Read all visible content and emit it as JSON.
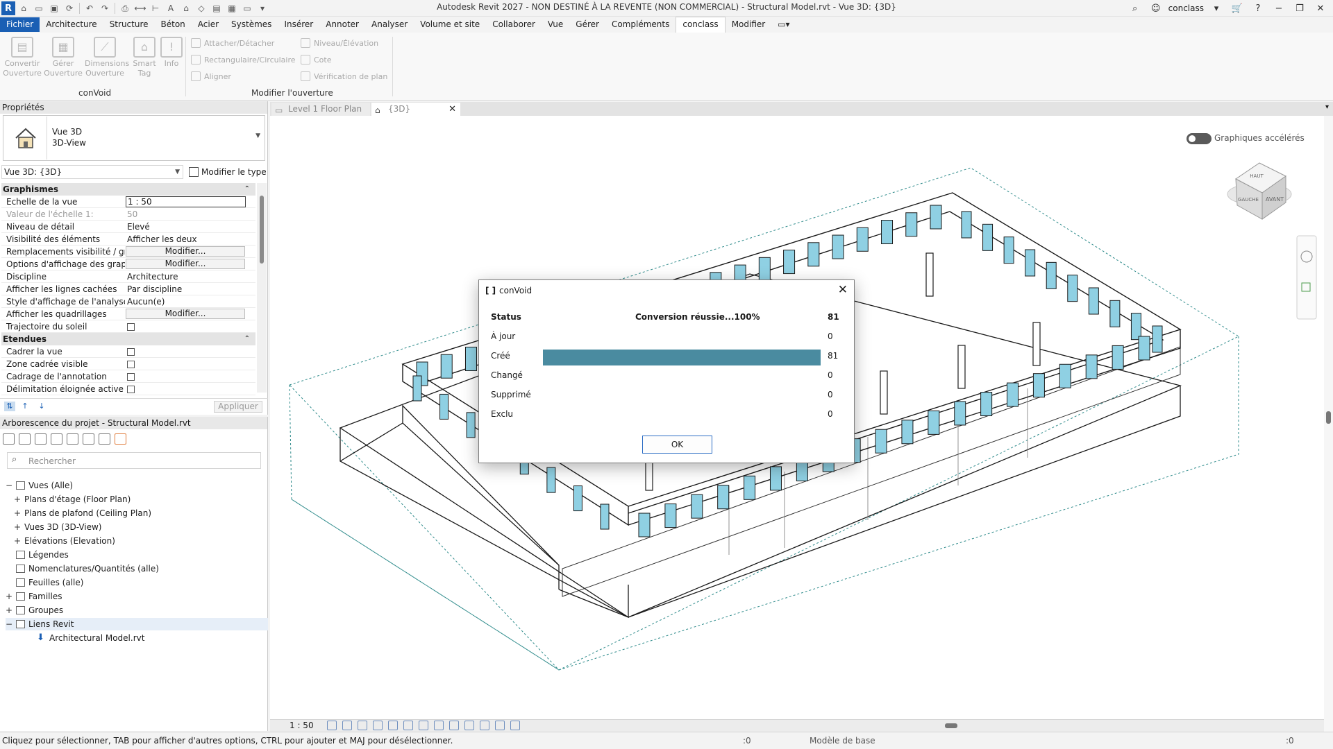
{
  "window": {
    "title": "Autodesk Revit 2027 - NON DESTINÉ À LA REVENTE (NON COMMERCIAL) - Structural Model.rvt - Vue 3D: {3D}",
    "app_letter": "R",
    "user": "conclass",
    "help": "?"
  },
  "menu": {
    "items": [
      "Fichier",
      "Architecture",
      "Structure",
      "Béton",
      "Acier",
      "Systèmes",
      "Insérer",
      "Annoter",
      "Analyser",
      "Volume et site",
      "Collaborer",
      "Vue",
      "Gérer",
      "Compléments",
      "conclass",
      "Modifier"
    ],
    "active": "conclass"
  },
  "ribbon": {
    "big_buttons": [
      {
        "label": "Convertir\nOuverture"
      },
      {
        "label": "Gérer\nOuverture"
      },
      {
        "label": "Dimensions\nOuverture"
      },
      {
        "label": "Smart\nTag"
      },
      {
        "label": "Info"
      }
    ],
    "small_left": [
      "Attacher/Détacher",
      "Rectangulaire/Circulaire",
      "Aligner"
    ],
    "small_right": [
      "Niveau/Élévation",
      "Cote",
      "Vérification de plan"
    ],
    "panel_labels": [
      "conVoid",
      "Modifier l'ouverture"
    ]
  },
  "properties": {
    "title": "Propriétés",
    "type_line1": "Vue 3D",
    "type_line2": "3D-View",
    "view_selector": "Vue 3D: {3D}",
    "edit_type": "Modifier le type",
    "apply": "Appliquer",
    "groups": [
      {
        "name": "Graphismes",
        "rows": [
          {
            "k": "Echelle de la vue",
            "v": "1 : 50",
            "kind": "input"
          },
          {
            "k": "Valeur de l'échelle    1:",
            "v": "50",
            "kind": "dim"
          },
          {
            "k": "Niveau de détail",
            "v": "Elevé",
            "kind": "text"
          },
          {
            "k": "Visibilité des éléments",
            "v": "Afficher les deux",
            "kind": "text"
          },
          {
            "k": "Remplacements visibilité / gr...",
            "v": "Modifier...",
            "kind": "button"
          },
          {
            "k": "Options d'affichage des grap...",
            "v": "Modifier...",
            "kind": "button"
          },
          {
            "k": "Discipline",
            "v": "Architecture",
            "kind": "text"
          },
          {
            "k": "Afficher les lignes cachées",
            "v": "Par discipline",
            "kind": "text"
          },
          {
            "k": "Style d'affichage de l'analyse ...",
            "v": "Aucun(e)",
            "kind": "text"
          },
          {
            "k": "Afficher les quadrillages",
            "v": "Modifier...",
            "kind": "button"
          },
          {
            "k": "Trajectoire du soleil",
            "v": "",
            "kind": "checkbox"
          }
        ]
      },
      {
        "name": "Etendues",
        "rows": [
          {
            "k": "Cadrer la vue",
            "v": "",
            "kind": "checkbox"
          },
          {
            "k": "Zone cadrée visible",
            "v": "",
            "kind": "checkbox"
          },
          {
            "k": "Cadrage de l'annotation",
            "v": "",
            "kind": "checkbox"
          },
          {
            "k": "Délimitation éloignée active",
            "v": "",
            "kind": "checkbox"
          }
        ]
      }
    ]
  },
  "browser": {
    "title": "Arborescence du projet - Structural Model.rvt",
    "search_placeholder": "Rechercher",
    "items": [
      {
        "label": "Vues (Alle)",
        "level": 0,
        "toggle": "−",
        "icon": true
      },
      {
        "label": "Plans d'étage (Floor Plan)",
        "level": 1,
        "toggle": "+",
        "icon": false
      },
      {
        "label": "Plans de plafond (Ceiling Plan)",
        "level": 1,
        "toggle": "+",
        "icon": false
      },
      {
        "label": "Vues 3D (3D-View)",
        "level": 1,
        "toggle": "+",
        "icon": false
      },
      {
        "label": "Elévations (Elevation)",
        "level": 1,
        "toggle": "+",
        "icon": false
      },
      {
        "label": "Légendes",
        "level": 0,
        "toggle": "",
        "icon": true
      },
      {
        "label": "Nomenclatures/Quantités (alle)",
        "level": 0,
        "toggle": "",
        "icon": true
      },
      {
        "label": "Feuilles (alle)",
        "level": 0,
        "toggle": "",
        "icon": true
      },
      {
        "label": "Familles",
        "level": 0,
        "toggle": "+",
        "icon": true
      },
      {
        "label": "Groupes",
        "level": 0,
        "toggle": "+",
        "icon": true
      },
      {
        "label": "Liens Revit",
        "level": 0,
        "toggle": "−",
        "icon": true
      },
      {
        "label": "Architectural Model.rvt",
        "level": 2,
        "toggle": "",
        "icon": true
      }
    ]
  },
  "tabs": [
    {
      "label": "Level 1 Floor Plan",
      "active": false
    },
    {
      "label": "{3D}",
      "active": true
    }
  ],
  "viewport": {
    "accel_label": "Graphiques accélérés",
    "viewcube": {
      "top": "HAUT",
      "left": "GAUCHE",
      "front": "AVANT"
    }
  },
  "view_bar": {
    "scale": "1 : 50"
  },
  "statusbar": {
    "message": "Cliquez pour sélectionner, TAB pour afficher d'autres options,  CTRL pour ajouter et MAJ pour désélectionner.",
    "count_a": ":0",
    "model": "Modèle de base",
    "filter": ":0"
  },
  "dialog": {
    "title": "conVoid",
    "status_label": "Status",
    "status_text": "Conversion réussie...100%",
    "status_count": "81",
    "rows": [
      {
        "label": "À jour",
        "count": "0"
      },
      {
        "label": "Créé",
        "count": "81",
        "progress": 1.0
      },
      {
        "label": "Changé",
        "count": "0"
      },
      {
        "label": "Supprimé",
        "count": "0"
      },
      {
        "label": "Exclu",
        "count": "0"
      }
    ],
    "ok": "OK"
  },
  "colors": {
    "accent": "#1a5fb4",
    "progress": "#4a8ba0",
    "window_glass": "#8fd0e3",
    "crop_box": "#2e8b8b"
  }
}
